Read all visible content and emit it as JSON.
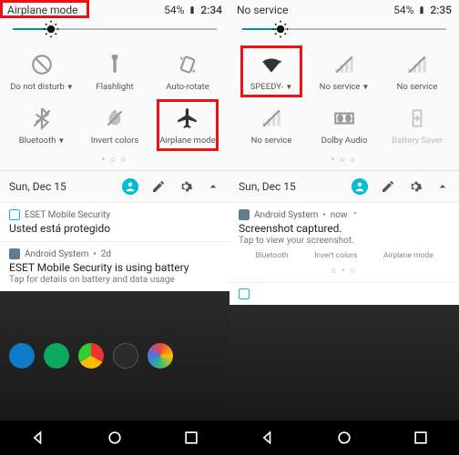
{
  "left": {
    "status_left": "Airplane mode",
    "battery": "54%",
    "time": "2:34",
    "tiles_row1": [
      {
        "name": "do-not-disturb",
        "label": "Do not disturb",
        "dropdown": true
      },
      {
        "name": "flashlight",
        "label": "Flashlight",
        "dropdown": false
      },
      {
        "name": "auto-rotate",
        "label": "Auto-rotate",
        "dropdown": false
      }
    ],
    "tiles_row2": [
      {
        "name": "bluetooth",
        "label": "Bluetooth",
        "dropdown": true
      },
      {
        "name": "invert-colors",
        "label": "Invert colors",
        "dropdown": false
      },
      {
        "name": "airplane-mode",
        "label": "Airplane mode",
        "dropdown": false
      }
    ],
    "dots": "• ○ ○",
    "footer_date": "Sun, Dec 15",
    "notif1": {
      "app": "ESET Mobile Security",
      "title": "Usted está protegido"
    },
    "notif2": {
      "app": "Android System",
      "time": "2d",
      "title": "ESET Mobile Security is using battery",
      "sub": "Tap for details on battery and data usage"
    }
  },
  "right": {
    "status_left": "No service",
    "battery": "54%",
    "time": "2:35",
    "tiles_row1": [
      {
        "name": "wifi",
        "label": "SPEEDY-",
        "dropdown": true
      },
      {
        "name": "no-service-1",
        "label": "No service",
        "dropdown": true
      },
      {
        "name": "no-service-2",
        "label": "No service",
        "dropdown": false
      }
    ],
    "tiles_row2": [
      {
        "name": "no-service-3",
        "label": "No service",
        "dropdown": false
      },
      {
        "name": "dolby",
        "label": "Dolby Audio",
        "dropdown": false
      },
      {
        "name": "battery-saver",
        "label": "Battery Saver",
        "dropdown": false,
        "disabled": true
      }
    ],
    "dots": "• ○ ○",
    "footer_date": "Sun, Dec 15",
    "notif1": {
      "app": "Android System",
      "time": "now",
      "title": "Screenshot captured.",
      "sub": "Tap to view your screenshot."
    },
    "mini_tiles": [
      "Bluetooth",
      "Invert colors",
      "Airplane mode"
    ],
    "mini_dots": "○ • ○"
  }
}
